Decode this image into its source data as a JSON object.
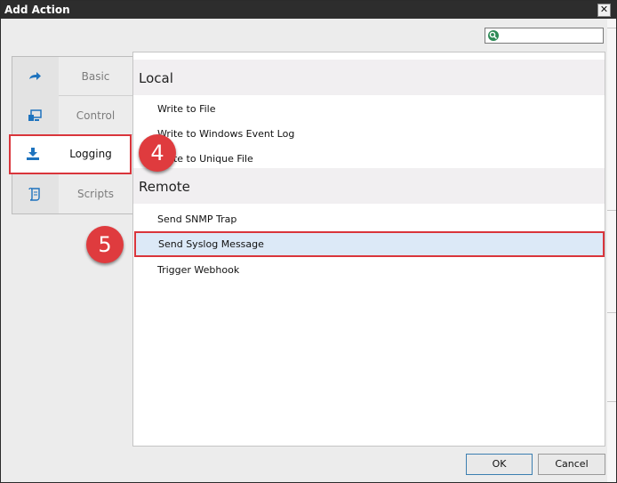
{
  "window": {
    "title": "Add Action",
    "close_label": "✕"
  },
  "search": {
    "value": "",
    "placeholder": ""
  },
  "categories": [
    {
      "label": "Basic",
      "icon": "arrow-forward-icon"
    },
    {
      "label": "Control",
      "icon": "monitor-icon"
    },
    {
      "label": "Logging",
      "icon": "download-tray-icon",
      "selected": true
    },
    {
      "label": "Scripts",
      "icon": "script-scroll-icon"
    }
  ],
  "groups": [
    {
      "header": "Local",
      "items": [
        "Write to File",
        "Write to Windows Event Log",
        "Write to Unique File"
      ]
    },
    {
      "header": "Remote",
      "items": [
        "Send SNMP Trap",
        "Send Syslog Message",
        "Trigger Webhook"
      ]
    }
  ],
  "badges": {
    "step4": "4",
    "step5": "5"
  },
  "buttons": {
    "ok": "OK",
    "cancel": "Cancel"
  },
  "colors": {
    "accent": "#1e73be",
    "annotation": "#df3b3e",
    "selection": "#dce9f7"
  }
}
